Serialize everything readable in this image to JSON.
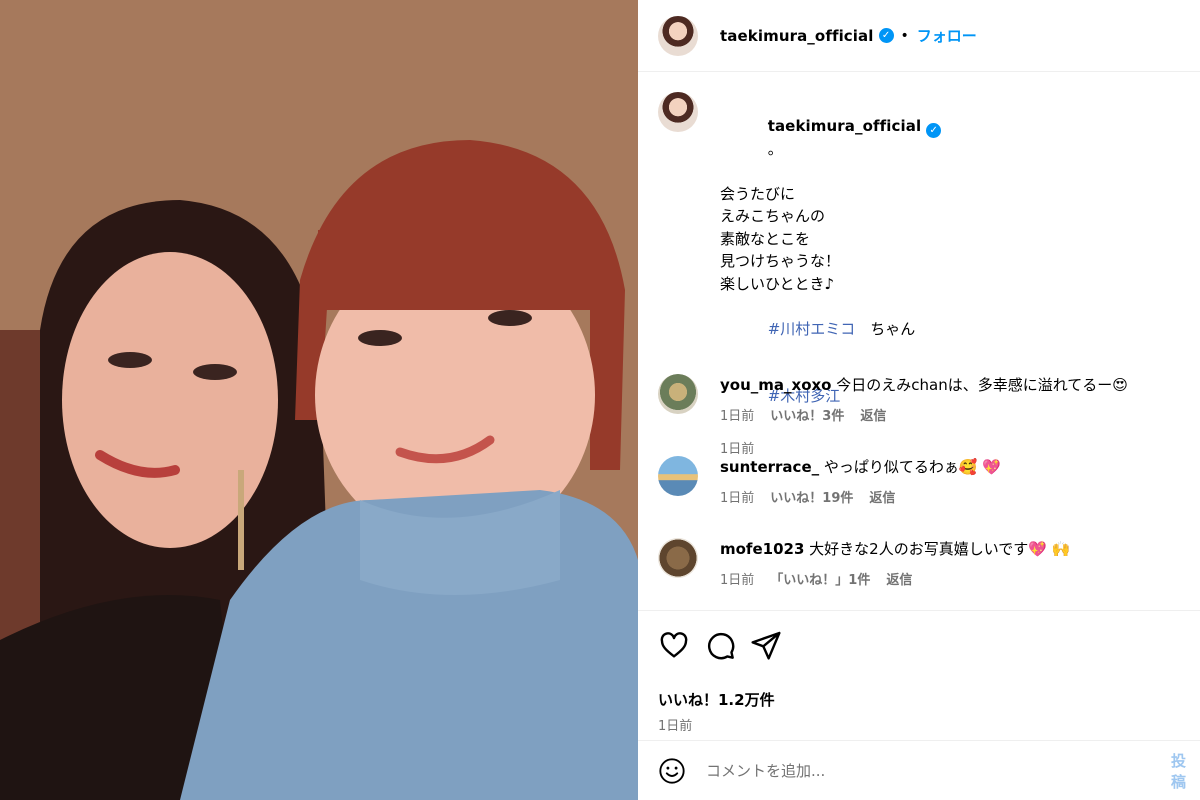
{
  "post": {
    "username": "taekimura_official",
    "follow_label": "フォロー",
    "separator": "•",
    "verified_glyph": "✓"
  },
  "caption": {
    "username": "taekimura_official",
    "lines": [
      "。",
      "会うたびに",
      "えみこちゃんの",
      "素敵なとこを",
      "見つけちゃうな！",
      "",
      "楽しいひととき♪",
      ""
    ],
    "hashtag_1": "#川村エミコ",
    "hashtag_1_suffix": "　ちゃん",
    "hashtag_2": "#木村多江",
    "time": "1日前"
  },
  "comments": [
    {
      "username": "you_ma_xoxo",
      "text": "今日のえみchanは、多幸感に溢れてるー😍",
      "time": "1日前",
      "likes": "いいね！3件",
      "reply": "返信"
    },
    {
      "username": "sunterrace_",
      "text": "やっぱり似てるわぁ🥰 💖",
      "time": "1日前",
      "likes": "いいね！19件",
      "reply": "返信"
    },
    {
      "username": "mofe1023",
      "text": "大好きな2人のお写真嬉しいです💖 🙌",
      "time": "1日前",
      "likes": "「いいね！」1件",
      "reply": "返信"
    }
  ],
  "actions": {
    "like_count": "いいね！1.2万件",
    "time": "1日前",
    "icons": [
      "heart-icon",
      "comment-icon",
      "share-icon"
    ]
  },
  "comment_box": {
    "placeholder": "コメントを追加...",
    "post_label": "投稿",
    "emoji_icon": "smile-icon"
  },
  "colors": {
    "accent": "#0095f6",
    "muted": "#737373",
    "hashtag": "#4065b4"
  }
}
